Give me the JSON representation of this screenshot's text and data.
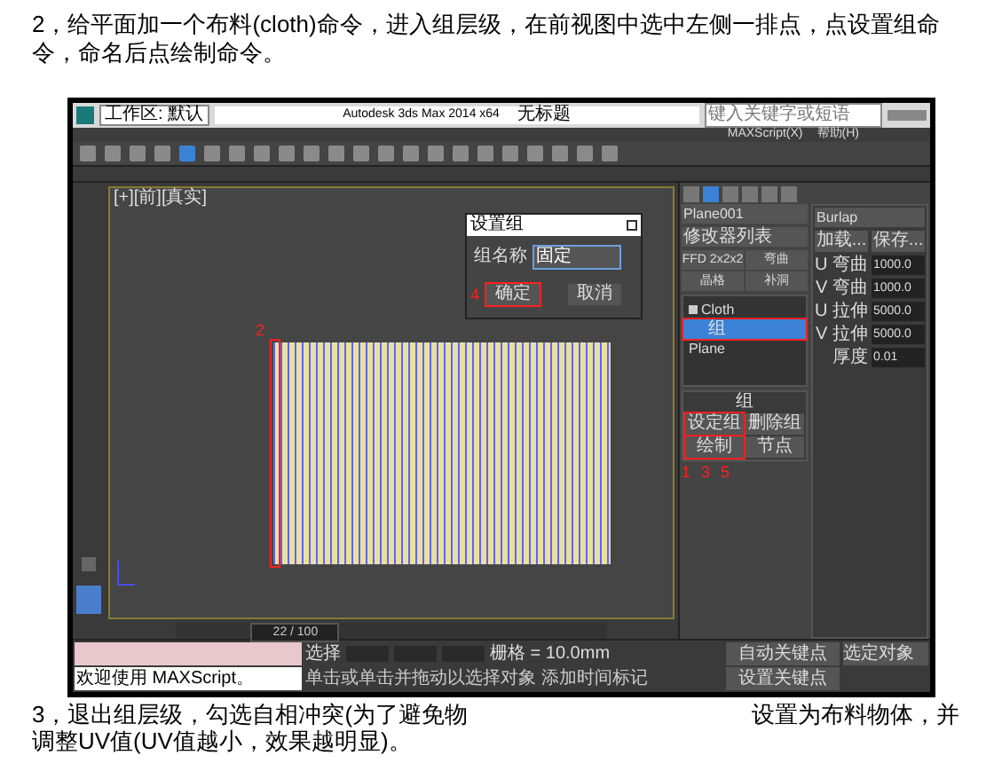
{
  "step2": "2，给平面加一个布料(cloth)命令，进入组层级，在前视图中选中左侧一排点，点设置组命令，命名后点绘制命令。",
  "window": {
    "title": "Autodesk 3ds Max 2014 x64",
    "document": "无标题",
    "workspace": "工作区: 默认",
    "search": {
      "placeholder": "键入关键字或短语"
    }
  },
  "menu": [
    "MAXScript(X)",
    "帮助(H)"
  ],
  "viewport": {
    "label": "[+][前][真实]",
    "cloth_marker": "2",
    "frame": "22 / 100",
    "level": 0.22
  },
  "dialog": {
    "title": "设置组",
    "field_label": "组名称",
    "value": "固定",
    "ok": "确定",
    "cancel": "取消",
    "ok_marker": "4"
  },
  "command_panel": {
    "object": "Plane001",
    "modifier_list": "修改器列表",
    "modifiers": [
      "FFD 2x2x2",
      "弯曲",
      "晶格",
      "补洞"
    ],
    "stack_marker": "1",
    "stack": [
      {
        "label": "Cloth",
        "expanded": true,
        "selected": false,
        "children": [
          {
            "label": "组",
            "selected": true
          }
        ]
      },
      {
        "label": "Plane",
        "selected": false
      }
    ],
    "group_rollout": {
      "title": "组",
      "buttons": [
        {
          "label": "设定组",
          "marker": "3"
        },
        {
          "label": "删除组"
        },
        {
          "label": "绘制",
          "marker": "5"
        },
        {
          "label": "节点"
        }
      ]
    },
    "preset": "Burlap",
    "load": "加载...",
    "save": "保存...",
    "properties": [
      {
        "label": "U 弯曲",
        "value": "1000.0"
      },
      {
        "label": "V 弯曲",
        "value": "1000.0"
      },
      {
        "label": "U 拉伸",
        "value": "5000.0"
      },
      {
        "label": "V 拉伸",
        "value": "5000.0"
      },
      {
        "label": "厚度",
        "value": "0.01"
      }
    ]
  },
  "status": {
    "listener": "欢迎使用 MAXScript。",
    "select": "选择",
    "grid": "栅格 = 10.0mm",
    "hint": "单击或单击并拖动以选择对象",
    "add_time": "添加时间标记",
    "auto_key": "自动关键点",
    "set_key": "设置关键点",
    "selected_objects": "选定对象"
  },
  "step3_parts": [
    "3，退出组层级，勾选自相冲突(为了避免物",
    "设置",
    "为布料物体，并调整UV值(UV值越小，效果越明显)。"
  ]
}
